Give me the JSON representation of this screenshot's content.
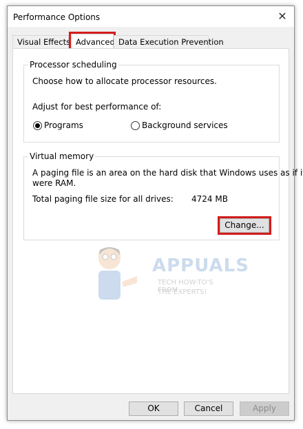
{
  "window": {
    "title": "Performance Options"
  },
  "tabs": [
    {
      "label": "Visual Effects"
    },
    {
      "label": "Advanced"
    },
    {
      "label": "Data Execution Prevention"
    }
  ],
  "processor": {
    "group_label": "Processor scheduling",
    "description": "Choose how to allocate processor resources.",
    "adjust_label": "Adjust for best performance of:",
    "option_programs": "Programs",
    "option_background": "Background services",
    "selected": "Programs"
  },
  "virtual_memory": {
    "group_label": "Virtual memory",
    "description_line1": "A paging file is an area on the hard disk that Windows uses as if it",
    "description_line2": "were RAM.",
    "total_label": "Total paging file size for all drives:",
    "total_value": "4724 MB",
    "change_button": "Change..."
  },
  "watermark": {
    "brand": "APPUALS",
    "tagline_line1": "TECH HOW-TO'S FROM",
    "tagline_line2": "THE EXPERTS!"
  },
  "footer": {
    "ok": "OK",
    "cancel": "Cancel",
    "apply": "Apply"
  },
  "colors": {
    "highlight": "#d41c1c",
    "dialog_bg": "#f0f0f0"
  }
}
